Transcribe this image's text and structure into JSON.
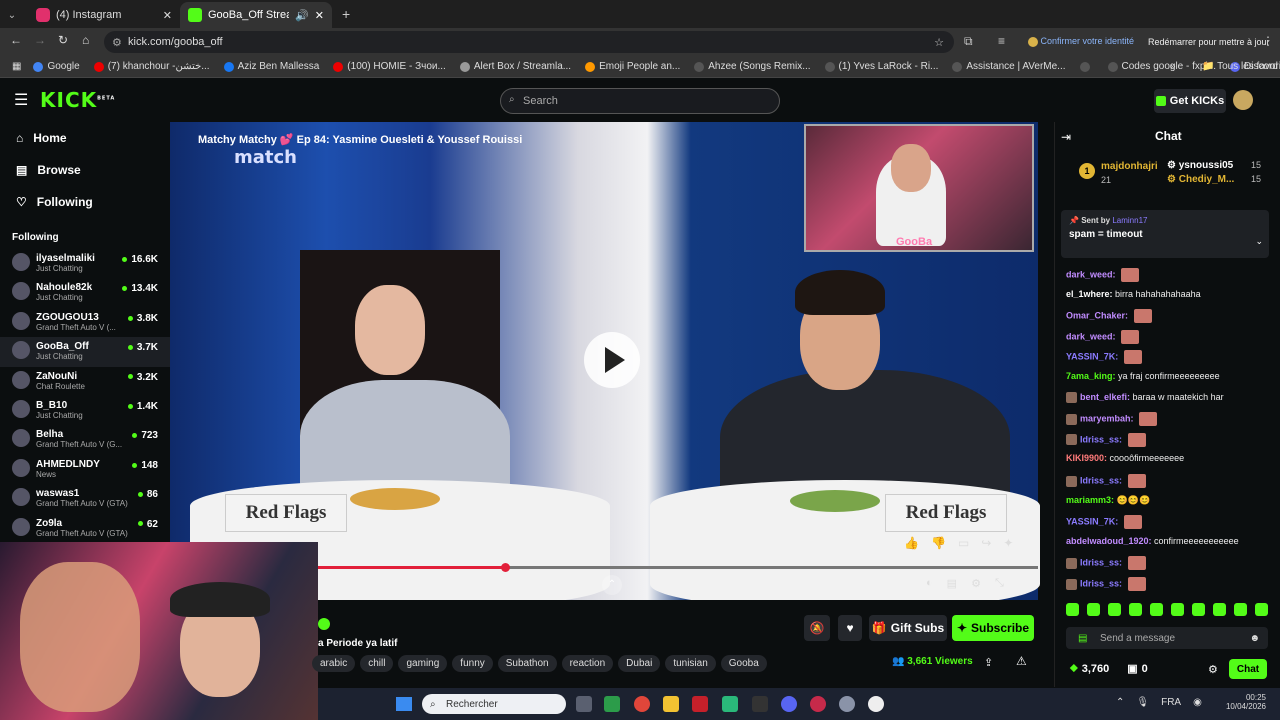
{
  "browser": {
    "tabs": [
      {
        "label": "(4) Instagram",
        "icon": "instagram-icon",
        "color": "#e1306c"
      },
      {
        "label": "GooBa_Off Stream - Watch",
        "icon": "kick-icon",
        "color": "#53fc18"
      }
    ],
    "url": "kick.com/gooba_off",
    "identity": "Confirmer votre identité",
    "restart": "Redémarrer pour mettre à jour",
    "bookmarks": [
      "Google",
      "(7) khanchour -ختشن...",
      "Aziz Ben Mallessa",
      "(100) HOMIE - Зчои...",
      "Alert Box / Streamla...",
      "Emoji People an...",
      "Ahzee (Songs Remix...",
      "(1) Yves LaRock - Ri...",
      "Assistance | AVerMe...",
      "",
      "Codes google - fxpi...",
      "Discord — Chat voc..."
    ],
    "all_favorites": "Tous les favoris"
  },
  "kick": {
    "logo": "KICK",
    "logo_sup": "BETA",
    "search_placeholder": "Search",
    "get_kicks": "Get KICKs"
  },
  "sidebar": {
    "nav": [
      {
        "label": "Home",
        "icon": "home-icon"
      },
      {
        "label": "Browse",
        "icon": "browse-icon"
      },
      {
        "label": "Following",
        "icon": "heart-icon"
      }
    ],
    "following_title": "Following",
    "following": [
      {
        "name": "ilyaselmaliki",
        "category": "Just Chatting",
        "viewers": "16.6K"
      },
      {
        "name": "Nahoule82k",
        "category": "Just Chatting",
        "viewers": "13.4K"
      },
      {
        "name": "ZGOUGOU13",
        "category": "Grand Theft Auto V (...",
        "viewers": "3.8K"
      },
      {
        "name": "GooBa_Off",
        "category": "Just Chatting",
        "viewers": "3.7K"
      },
      {
        "name": "ZaNouNi",
        "category": "Chat Roulette",
        "viewers": "3.2K"
      },
      {
        "name": "B_B10",
        "category": "Just Chatting",
        "viewers": "1.4K"
      },
      {
        "name": "Belha",
        "category": "Grand Theft Auto V (G...",
        "viewers": "723"
      },
      {
        "name": "AHMEDLNDY",
        "category": "News",
        "viewers": "148"
      },
      {
        "name": "waswas1",
        "category": "Grand Theft Auto V (GTA)",
        "viewers": "86"
      },
      {
        "name": "Zo9la",
        "category": "Grand Theft Auto V (GTA)",
        "viewers": "62"
      }
    ]
  },
  "video": {
    "title": "Matchy Matchy 💕 Ep 84: Yasmine Ouesleti & Youssef Rouissi",
    "show_logo": "match",
    "sign_left": "Red Flags",
    "sign_right": "Red Flags",
    "webcam_label": "GooBa",
    "progress": 0.26
  },
  "stream": {
    "title": "a Periode ya latif",
    "tags": [
      "arabic",
      "chill",
      "gaming",
      "funny",
      "Subathon",
      "reaction",
      "Dubai",
      "tunisian",
      "Gooba"
    ],
    "viewers": "3,661",
    "viewers_label": "Viewers",
    "gift_subs": "Gift Subs",
    "subscribe": "Subscribe"
  },
  "chat": {
    "title": "Chat",
    "leader_rank": "1",
    "leader_name": "majdonhajri",
    "leader_count": "21",
    "gift_users": [
      {
        "name": "ysnoussi05",
        "count": "15"
      },
      {
        "name": "Chediy_M...",
        "count": "15"
      }
    ],
    "pinned_sent_by": "Sent by",
    "pinned_user": "Laminn17",
    "pinned_text": "spam = timeout",
    "messages": [
      {
        "user": "dark_weed:",
        "text": "",
        "emote": true,
        "color": "#c18cff",
        "badge": false
      },
      {
        "user": "el_1where:",
        "text": "birra hahahahahaaha",
        "emote": false,
        "color": "#ffffff",
        "badge": false
      },
      {
        "user": "Omar_Chaker:",
        "text": "",
        "emote": true,
        "color": "#c18cff",
        "badge": false
      },
      {
        "user": "dark_weed:",
        "text": "",
        "emote": true,
        "color": "#c18cff",
        "badge": false
      },
      {
        "user": "YASSIN_7K:",
        "text": "",
        "emote": true,
        "color": "#8b7bff",
        "badge": false
      },
      {
        "user": "7ama_king:",
        "text": "ya fraj confirmeeeeeeeee",
        "emote": false,
        "color": "#53fc18",
        "badge": false
      },
      {
        "user": "bent_elkefi:",
        "text": "baraa w maatekich har",
        "emote": false,
        "color": "#c18cff",
        "badge": true
      },
      {
        "user": "maryembah:",
        "text": "",
        "emote": true,
        "color": "#c18cff",
        "badge": true
      },
      {
        "user": "Idriss_ss:",
        "text": "",
        "emote": true,
        "color": "#8b7bff",
        "badge": true
      },
      {
        "user": "KIKI9900:",
        "text": "coooôfirmeeeeeee",
        "emote": false,
        "color": "#ff7b7b",
        "badge": false
      },
      {
        "user": "Idriss_ss:",
        "text": "",
        "emote": true,
        "color": "#8b7bff",
        "badge": true
      },
      {
        "user": "mariamm3:",
        "text": "😊😊😊",
        "emote": false,
        "color": "#53fc18",
        "badge": false
      },
      {
        "user": "YASSIN_7K:",
        "text": "",
        "emote": true,
        "color": "#8b7bff",
        "badge": false
      },
      {
        "user": "abdelwadoud_1920:",
        "text": "confirmeeeeeeeeeee",
        "emote": false,
        "color": "#c18cff",
        "badge": false
      },
      {
        "user": "Idriss_ss:",
        "text": "",
        "emote": true,
        "color": "#8b7bff",
        "badge": true
      },
      {
        "user": "Idriss_ss:",
        "text": "",
        "emote": true,
        "color": "#8b7bff",
        "badge": true
      }
    ],
    "send_placeholder": "Send a message",
    "points": "3,760",
    "other_count": "0",
    "chat_button": "Chat"
  },
  "taskbar": {
    "search_placeholder": "Rechercher",
    "lang": "FRA",
    "time": "00:25",
    "date": "10/04/2026"
  },
  "colors": {
    "kick_green": "#53fc18",
    "progress_red": "#e2203a"
  }
}
